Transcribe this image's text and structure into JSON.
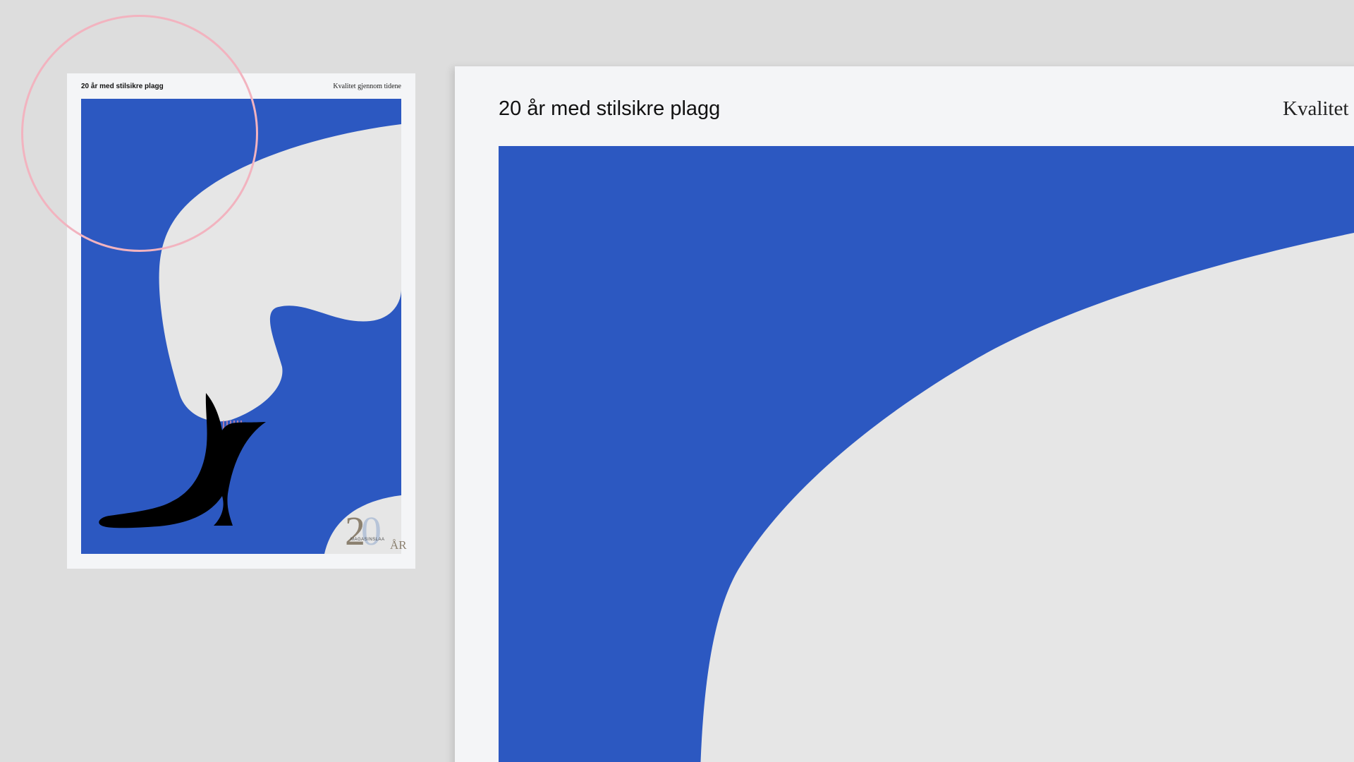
{
  "poster": {
    "title": "20 år med stilsikre plagg",
    "tagline": "Kvalitet gjennom tidene",
    "tagline_zoomed": "Kvalitet",
    "badge": {
      "number_first": "2",
      "number_second": "0",
      "suffix": "ÅR",
      "brand": "MAGASINSLAA"
    }
  },
  "colors": {
    "background": "#dddddd",
    "paper": "#f4f5f7",
    "blue": "#2c58c1",
    "cream": "#e6e6e6",
    "ink": "#000000",
    "highlight_ring": "#f2b3bf",
    "gold": "#8c8170"
  }
}
